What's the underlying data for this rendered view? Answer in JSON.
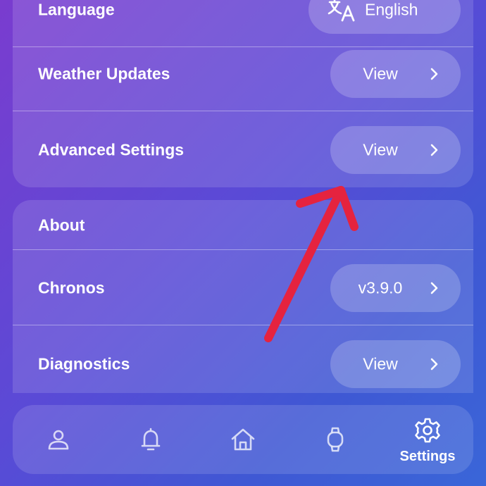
{
  "settings_section": {
    "rows": [
      {
        "label": "Language",
        "value": "English",
        "icon": "translate-icon"
      },
      {
        "label": "Weather Updates",
        "value": "View",
        "icon": "chevron-right-icon"
      },
      {
        "label": "Advanced Settings",
        "value": "View",
        "icon": "chevron-right-icon"
      }
    ]
  },
  "about_section": {
    "header": "About",
    "rows": [
      {
        "label": "Chronos",
        "value": "v3.9.0",
        "icon": "chevron-right-icon"
      },
      {
        "label": "Diagnostics",
        "value": "View",
        "icon": "chevron-right-icon"
      }
    ]
  },
  "bottom_nav": {
    "items": [
      {
        "icon": "profile-icon",
        "label": ""
      },
      {
        "icon": "bell-icon",
        "label": ""
      },
      {
        "icon": "home-icon",
        "label": ""
      },
      {
        "icon": "watch-icon",
        "label": ""
      },
      {
        "icon": "gear-icon",
        "label": "Settings",
        "active": true
      }
    ]
  },
  "colors": {
    "background_start": "#7a3ccf",
    "background_end": "#3a66d8",
    "annotation_arrow": "#e5233f",
    "text": "#ffffff"
  }
}
